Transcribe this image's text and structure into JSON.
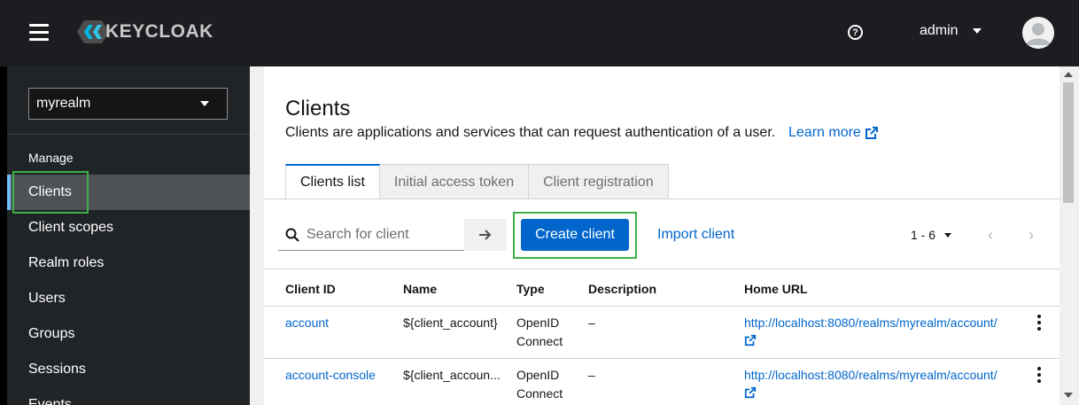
{
  "header": {
    "logo_text": "KEYCLOAK",
    "help_symbol": "?",
    "user_name": "admin"
  },
  "sidebar": {
    "realm": "myrealm",
    "section_label": "Manage",
    "items": [
      {
        "label": "Clients",
        "active": true
      },
      {
        "label": "Client scopes"
      },
      {
        "label": "Realm roles"
      },
      {
        "label": "Users"
      },
      {
        "label": "Groups"
      },
      {
        "label": "Sessions"
      },
      {
        "label": "Events"
      }
    ]
  },
  "main": {
    "title": "Clients",
    "description": "Clients are applications and services that can request authentication of a user.",
    "learn_more": "Learn more",
    "tabs": [
      {
        "label": "Clients list",
        "active": true
      },
      {
        "label": "Initial access token"
      },
      {
        "label": "Client registration"
      }
    ],
    "search_placeholder": "Search for client",
    "create_button": "Create client",
    "import_button": "Import client",
    "pagination": "1 - 6",
    "columns": [
      "Client ID",
      "Name",
      "Type",
      "Description",
      "Home URL"
    ],
    "rows": [
      {
        "client_id": "account",
        "name": "${client_account}",
        "type_line1": "OpenID",
        "type_line2": "Connect",
        "description": "–",
        "home_url": "http://localhost:8080/realms/myrealm/account/"
      },
      {
        "client_id": "account-console",
        "name": "${client_accoun...",
        "type_line1": "OpenID",
        "type_line2": "Connect",
        "description": "–",
        "home_url": "http://localhost:8080/realms/myrealm/account/"
      }
    ]
  },
  "colors": {
    "accent": "#0066cc",
    "highlight": "#3fb049",
    "header_bg": "#1b1d21",
    "sidebar_bg": "#212427"
  }
}
